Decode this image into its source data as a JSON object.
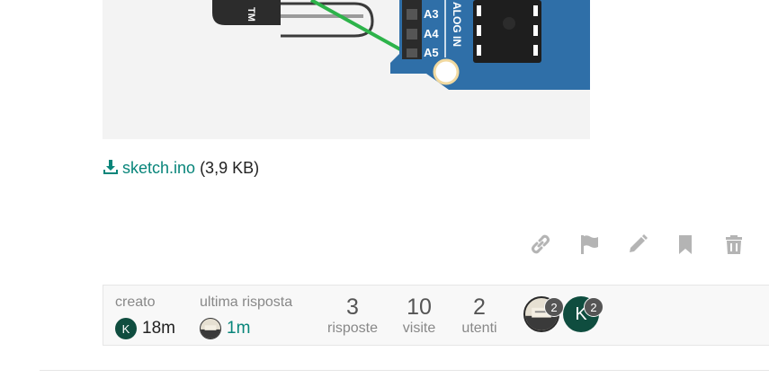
{
  "attachment": {
    "filename": "sketch.ino",
    "size": "(3,9 KB)",
    "icon": "download-icon"
  },
  "diagram": {
    "pin_labels": [
      "A3",
      "A4",
      "A5"
    ],
    "header_label": "ALOG IN",
    "component_label": "TM",
    "wire_color": "#2db34a",
    "board_color": "#2f6fa8"
  },
  "post_actions": [
    {
      "name": "link-icon"
    },
    {
      "name": "flag-icon"
    },
    {
      "name": "pencil-icon"
    },
    {
      "name": "bookmark-icon"
    },
    {
      "name": "trash-icon"
    }
  ],
  "topic_map": {
    "created": {
      "label": "creato",
      "avatar_letter": "K",
      "value": "18m"
    },
    "last_reply": {
      "label": "ultima risposta",
      "value": "1m"
    },
    "stats": [
      {
        "value": "3",
        "label": "risposte"
      },
      {
        "value": "10",
        "label": "visite"
      },
      {
        "value": "2",
        "label": "utenti"
      }
    ],
    "participants": [
      {
        "letter": "",
        "count": "2"
      },
      {
        "letter": "K",
        "count": "2"
      }
    ]
  },
  "colors": {
    "link": "#08857a",
    "avatar_green": "#0f4d3f",
    "badge": "#555555",
    "action_icon": "#b4b4b4"
  }
}
